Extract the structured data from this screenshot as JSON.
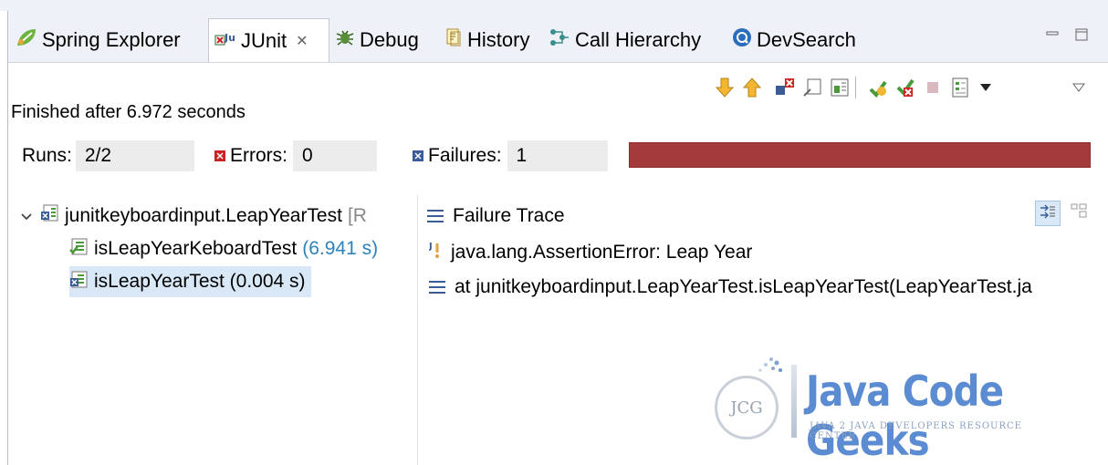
{
  "tabs": [
    {
      "label": "Spring Explorer",
      "icon": "spring-leaf-icon"
    },
    {
      "label": "JUnit",
      "icon": "junit-icon",
      "active": true,
      "close": "✕"
    },
    {
      "label": "Debug",
      "icon": "debug-bug-icon"
    },
    {
      "label": "History",
      "icon": "history-icon"
    },
    {
      "label": "Call Hierarchy",
      "icon": "call-hierarchy-icon"
    },
    {
      "label": "DevSearch",
      "icon": "devsearch-icon"
    }
  ],
  "status": {
    "text": "Finished after 6.972 seconds"
  },
  "counters": {
    "runs_label": "Runs:",
    "runs_value": "2/2",
    "errors_label": "Errors:",
    "errors_value": "0",
    "failures_label": "Failures:",
    "failures_value": "1"
  },
  "progress": {
    "fraction": 1.0,
    "color": "#a33b3b"
  },
  "tree": {
    "suite": {
      "name": "junitkeyboardinput.LeapYearTest",
      "suffix": "[R"
    },
    "tests": [
      {
        "name": "isLeapYearKeboardTest",
        "time": "(6.941 s)",
        "status": "passed"
      },
      {
        "name": "isLeapYearTest (0.004 s)",
        "time": "",
        "status": "failed",
        "selected": true
      }
    ]
  },
  "trace": {
    "title": "Failure Trace",
    "lines": [
      "java.lang.AssertionError: Leap Year",
      "at junitkeyboardinput.LeapYearTest.isLeapYearTest(LeapYearTest.ja"
    ]
  },
  "logo": {
    "name": "Java Code Geeks",
    "tagline": "JAVA 2 JAVA DEVELOPERS RESOURCE CENTER",
    "badge": "JCG"
  },
  "colors": {
    "accent": "#2d82b8",
    "failure": "#a33b3b",
    "selection": "#d9e8f6"
  }
}
